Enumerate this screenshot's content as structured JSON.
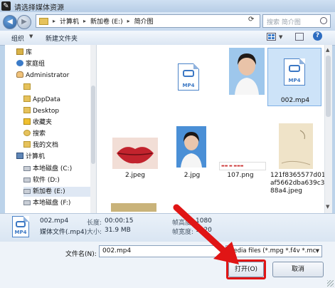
{
  "window": {
    "title": "请选择媒体资源"
  },
  "address": {
    "path": [
      "计算机",
      "新加卷 (E:)",
      "简介图"
    ],
    "search_placeholder": "搜索 简介图"
  },
  "toolbar": {
    "organize": "组织",
    "new_folder": "新建文件夹"
  },
  "nav": {
    "items": [
      {
        "label": "库",
        "icon": "library-icon"
      },
      {
        "label": "家庭组",
        "icon": "homegroup-icon"
      },
      {
        "label": "Administrator",
        "icon": "user-icon"
      },
      {
        "label": "",
        "icon": "folder-icon"
      },
      {
        "label": "AppData",
        "icon": "folder-icon"
      },
      {
        "label": "Desktop",
        "icon": "folder-icon"
      },
      {
        "label": "收藏夹",
        "icon": "favorites-icon"
      },
      {
        "label": "搜索",
        "icon": "search-folder-icon"
      },
      {
        "label": "我的文档",
        "icon": "folder-icon"
      },
      {
        "label": "计算机",
        "icon": "computer-icon"
      },
      {
        "label": "本地磁盘 (C:)",
        "icon": "drive-icon"
      },
      {
        "label": "软件 (D:)",
        "icon": "drive-icon"
      },
      {
        "label": "新加卷 (E:)",
        "icon": "drive-icon"
      },
      {
        "label": "本地磁盘 (F:)",
        "icon": "drive-icon"
      }
    ]
  },
  "files": [
    {
      "name": "",
      "type": "video",
      "badge": "MP4"
    },
    {
      "name": "",
      "type": "image"
    },
    {
      "name": "002.mp4",
      "type": "video",
      "badge": "MP4",
      "selected": true
    },
    {
      "name": "2.jpeg",
      "type": "image"
    },
    {
      "name": "2.jpg",
      "type": "image"
    },
    {
      "name": "107.png",
      "type": "image"
    },
    {
      "name": "121f8365577d01af5662dba639c388a4.jpeg",
      "type": "image"
    }
  ],
  "details": {
    "badge": "MP4",
    "name": "002.mp4",
    "kind": "媒体文件(.mp4)",
    "duration_label": "长度:",
    "duration": "00:00:15",
    "size_label": "大小:",
    "size": "31.9 MB",
    "frame_height_label": "帧高度:",
    "frame_height": "1080",
    "frame_width_label": "帧宽度:",
    "frame_width": "1920"
  },
  "form": {
    "filename_label": "文件名(N):",
    "filename_value": "002.mp4",
    "filetype_value": "Media files (*.mpg *.f4v *.mc",
    "open_label": "打开(O)",
    "cancel_label": "取消"
  },
  "colors": {
    "highlight": "#e01515",
    "selection": "#cde3f8"
  }
}
